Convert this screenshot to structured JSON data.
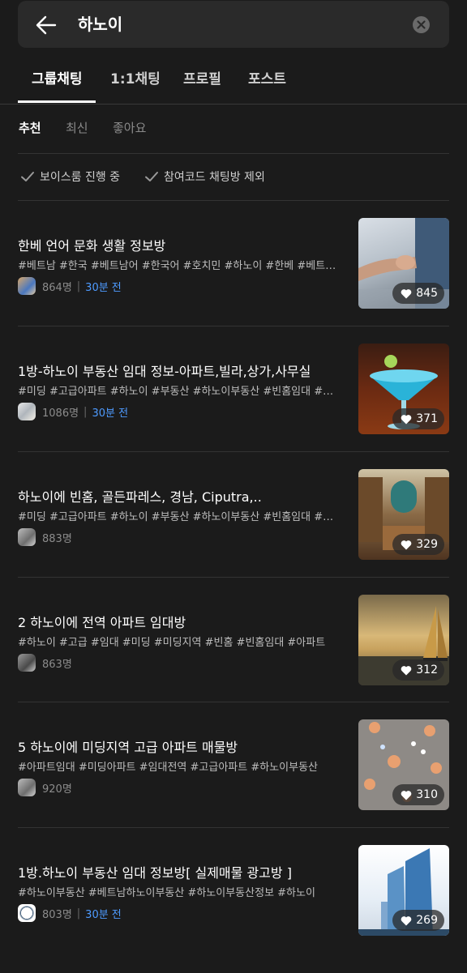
{
  "search": {
    "query": "하노이"
  },
  "tabs": [
    "그룹채팅",
    "1:1채팅",
    "프로필",
    "포스트"
  ],
  "filters": [
    "추천",
    "최신",
    "좋아요"
  ],
  "toggles": [
    "보이스룸 진행 중",
    "참여코드 채팅방 제외"
  ],
  "rooms": [
    {
      "title": "한베 언어 문화 생활 정보방",
      "tags": "#베트남 #한국 #베트남어 #한국어 #호치민 #하노이 #한베 #베트남생활",
      "members": "864명",
      "time": "30분 전",
      "likes": "845"
    },
    {
      "title": "1방-하노이 부동산 임대 정보-아파트,빌라,상가,사무실",
      "tags": "#미딩 #고급아파트 #하노이 #부동산 #하노이부동산 #빈홈임대 #아파트",
      "members": "1086명",
      "time": "30분 전",
      "likes": "371"
    },
    {
      "title": "하노이에 빈홈, 골든파레스, 경남, Ciputra,..",
      "tags": "#미딩 #고급아파트 #하노이 #부동산 #하노이부동산 #빈홈임대 #아파트",
      "members": "883명",
      "time": "",
      "likes": "329"
    },
    {
      "title": "2 하노이에 전역 아파트 임대방",
      "tags": "#하노이 #고급 #임대 #미딩 #미딩지역 #빈홈 #빈홈임대 #아파트",
      "members": "863명",
      "time": "",
      "likes": "312"
    },
    {
      "title": "5 하노이에 미딩지역 고급 아파트 매물방",
      "tags": "#아파트임대 #미딩아파트 #임대전역 #고급아파트 #하노이부동산",
      "members": "920명",
      "time": "",
      "likes": "310"
    },
    {
      "title": "1방.하노이 부동산 임대 정보방[ 실제매물 광고방 ]",
      "tags": "#하노이부동산 #베트남하노이부동산 #하노이부동산정보 #하노이",
      "members": "803명",
      "time": "30분 전",
      "likes": "269"
    }
  ],
  "colors": {
    "background": "#1b1b1b",
    "accent_time": "#4e9bff"
  }
}
